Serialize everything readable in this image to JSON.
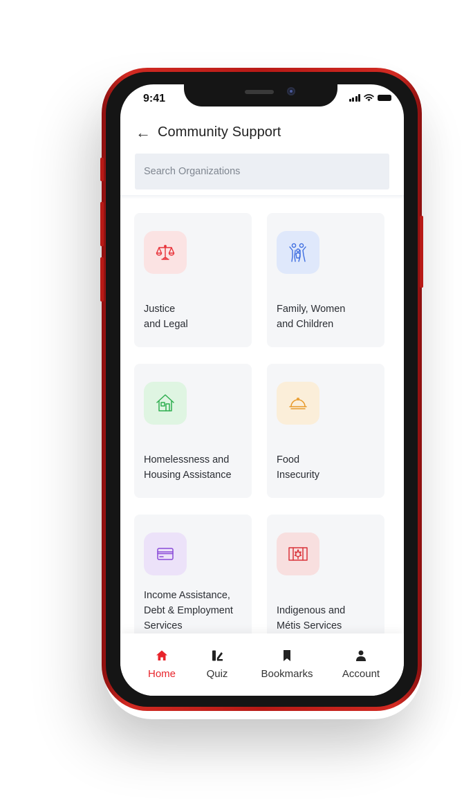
{
  "status_bar": {
    "time": "9:41"
  },
  "header": {
    "title": "Community Support"
  },
  "search": {
    "placeholder": "Search Organizations"
  },
  "categories": [
    {
      "label": "Justice\nand Legal",
      "icon": "scales-icon",
      "color": "#e8333a",
      "bg": "#fbe3e3"
    },
    {
      "label": "Family, Women\nand Children",
      "icon": "family-icon",
      "color": "#3d6de0",
      "bg": "#dfe8fb"
    },
    {
      "label": "Homelessness and\nHousing Assistance",
      "icon": "house-icon",
      "color": "#2fae4f",
      "bg": "#dff5e2"
    },
    {
      "label": "Food\nInsecurity",
      "icon": "cloche-icon",
      "color": "#e89a2a",
      "bg": "#fbeed9"
    },
    {
      "label": "Income Assistance,\nDebt & Employment\nServices",
      "icon": "credit-card-icon",
      "color": "#8a4ad8",
      "bg": "#ece2f9"
    },
    {
      "label": "Indigenous and\nMétis Services",
      "icon": "flag-icon",
      "color": "#d9343a",
      "bg": "#f8dfdf"
    }
  ],
  "tabs": [
    {
      "label": "Home",
      "icon": "home-icon",
      "active": true
    },
    {
      "label": "Quiz",
      "icon": "quiz-icon",
      "active": false
    },
    {
      "label": "Bookmarks",
      "icon": "bookmark-icon",
      "active": false
    },
    {
      "label": "Account",
      "icon": "person-icon",
      "active": false
    }
  ],
  "colors": {
    "accent": "#e8242b",
    "phone_body": "#c21e18"
  }
}
